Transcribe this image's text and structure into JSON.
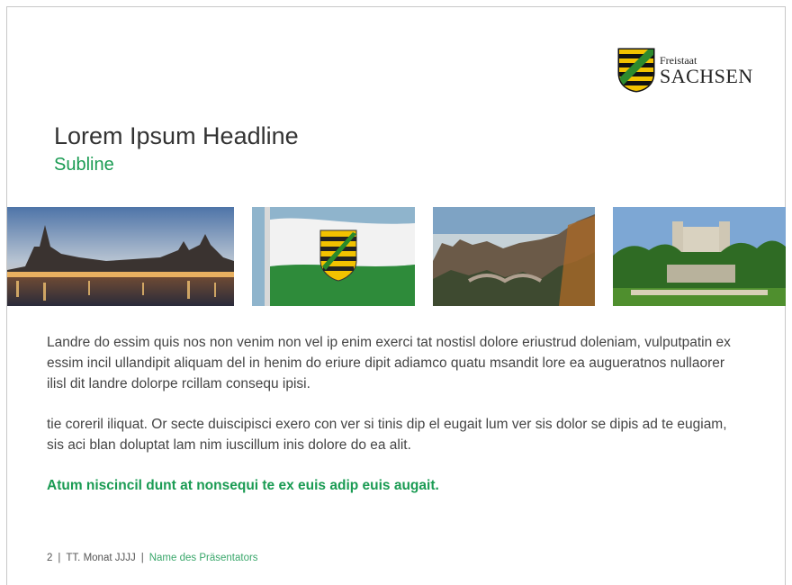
{
  "logo": {
    "small": "Freistaat",
    "big": "SACHSEN",
    "icon": "saxony-coat-of-arms-icon"
  },
  "headline": "Lorem Ipsum Headline",
  "subline": "Subline",
  "photos": [
    {
      "icon": "dresden-skyline-photo"
    },
    {
      "icon": "saxony-flag-photo"
    },
    {
      "icon": "bastei-bridge-photo"
    },
    {
      "icon": "castle-park-photo"
    }
  ],
  "paragraphs": [
    "Landre do essim quis nos non venim non vel ip enim exerci tat nostisl dolore eriustrud doleniam, vulputpatin ex essim incil ullandipit aliquam del in henim do eriure dipit adiamco quatu msandit lore ea augueratnos nullaorer ilisl dit landre dolorpe rcillam consequ ipisi.",
    "tie coreril iliquat. Or secte duiscipisci exero con ver si tinis dip el eugait lum ver sis dolor se dipis ad te eugiam, sis aci blan doluptat lam nim iuscillum inis dolore do ea alit."
  ],
  "emphasis": "Atum niscincil dunt at nonsequi te ex euis adip euis augait.",
  "footer": {
    "page": "2",
    "date": "TT. Monat JJJJ",
    "presenter": "Name des Präsentators"
  },
  "colors": {
    "accent_green": "#1a9b53",
    "text": "#444444"
  }
}
